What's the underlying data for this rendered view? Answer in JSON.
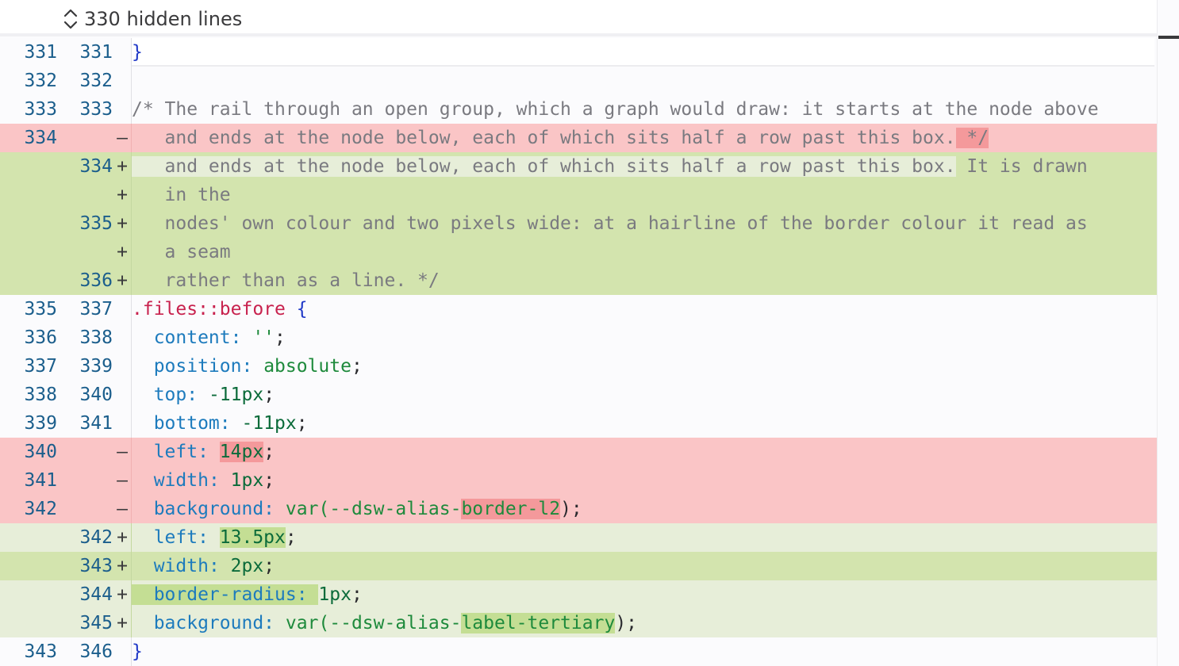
{
  "hidden": {
    "label": "330 hidden lines"
  },
  "lines": [
    {
      "type": "ctx",
      "old": "331",
      "new": "331",
      "sign": "",
      "segments": [
        {
          "t": "}",
          "c": "tok-brace"
        }
      ]
    },
    {
      "type": "ctx",
      "old": "332",
      "new": "332",
      "sign": "",
      "segments": []
    },
    {
      "type": "ctx",
      "old": "333",
      "new": "333",
      "sign": "",
      "segments": [
        {
          "t": "/* The rail through an open group, which a graph would draw: it starts at the node above",
          "c": "tok-comment"
        }
      ]
    },
    {
      "type": "del",
      "old": "334",
      "new": "",
      "sign": "—",
      "segments": [
        {
          "t": "   and ends at the node below, each of which sits half a row past this box.",
          "c": "tok-comment"
        },
        {
          "t": " */",
          "c": "tok-comment hl-del"
        }
      ]
    },
    {
      "type": "add",
      "strong": true,
      "old": "",
      "new": "334",
      "sign": "+",
      "segments": [
        {
          "t": "   and ends at the node below, each of which sits half a row past this box.",
          "c": "tok-comment hl-plain"
        },
        {
          "t": " It is drawn",
          "c": "tok-comment"
        }
      ]
    },
    {
      "type": "add",
      "strong": true,
      "old": "",
      "new": "",
      "sign": "+",
      "segments": [
        {
          "t": "   in the",
          "c": "tok-comment"
        }
      ]
    },
    {
      "type": "add",
      "strong": true,
      "old": "",
      "new": "335",
      "sign": "+",
      "segments": [
        {
          "t": "   nodes' own colour and two pixels wide: at a hairline of the border colour it read as",
          "c": "tok-comment"
        }
      ]
    },
    {
      "type": "add",
      "strong": true,
      "old": "",
      "new": "",
      "sign": "+",
      "segments": [
        {
          "t": "   a seam",
          "c": "tok-comment"
        }
      ]
    },
    {
      "type": "add",
      "strong": true,
      "old": "",
      "new": "336",
      "sign": "+",
      "segments": [
        {
          "t": "   rather than as a line. */",
          "c": "tok-comment"
        }
      ]
    },
    {
      "type": "ctx",
      "old": "335",
      "new": "337",
      "sign": "",
      "segments": [
        {
          "t": ".files::before",
          "c": "tok-selector"
        },
        {
          "t": " {",
          "c": "tok-brace"
        }
      ]
    },
    {
      "type": "ctx",
      "old": "336",
      "new": "338",
      "sign": "",
      "segments": [
        {
          "t": "  content",
          "c": "tok-prop"
        },
        {
          "t": ": ",
          "c": "tok-prop"
        },
        {
          "t": "''",
          "c": "tok-val"
        },
        {
          "t": ";",
          "c": "tok-punct"
        }
      ]
    },
    {
      "type": "ctx",
      "old": "337",
      "new": "339",
      "sign": "",
      "segments": [
        {
          "t": "  position",
          "c": "tok-prop"
        },
        {
          "t": ": ",
          "c": "tok-prop"
        },
        {
          "t": "absolute",
          "c": "tok-val"
        },
        {
          "t": ";",
          "c": "tok-punct"
        }
      ]
    },
    {
      "type": "ctx",
      "old": "338",
      "new": "340",
      "sign": "",
      "segments": [
        {
          "t": "  top",
          "c": "tok-prop"
        },
        {
          "t": ": ",
          "c": "tok-prop"
        },
        {
          "t": "-11px",
          "c": "tok-num"
        },
        {
          "t": ";",
          "c": "tok-punct"
        }
      ]
    },
    {
      "type": "ctx",
      "old": "339",
      "new": "341",
      "sign": "",
      "segments": [
        {
          "t": "  bottom",
          "c": "tok-prop"
        },
        {
          "t": ": ",
          "c": "tok-prop"
        },
        {
          "t": "-11px",
          "c": "tok-num"
        },
        {
          "t": ";",
          "c": "tok-punct"
        }
      ]
    },
    {
      "type": "del",
      "old": "340",
      "new": "",
      "sign": "—",
      "segments": [
        {
          "t": "  left",
          "c": "tok-prop"
        },
        {
          "t": ": ",
          "c": "tok-prop"
        },
        {
          "t": "14px",
          "c": "tok-num hl-del"
        },
        {
          "t": ";",
          "c": "tok-punct"
        }
      ]
    },
    {
      "type": "del",
      "old": "341",
      "new": "",
      "sign": "—",
      "segments": [
        {
          "t": "  width",
          "c": "tok-prop"
        },
        {
          "t": ": ",
          "c": "tok-prop"
        },
        {
          "t": "1px",
          "c": "tok-num"
        },
        {
          "t": ";",
          "c": "tok-punct"
        }
      ]
    },
    {
      "type": "del",
      "old": "342",
      "new": "",
      "sign": "—",
      "segments": [
        {
          "t": "  background",
          "c": "tok-prop"
        },
        {
          "t": ": ",
          "c": "tok-prop"
        },
        {
          "t": "var(--dsw-alias-",
          "c": "tok-val"
        },
        {
          "t": "border-l2",
          "c": "tok-val hl-del"
        },
        {
          "t": ");",
          "c": "tok-punct"
        }
      ]
    },
    {
      "type": "add",
      "strong": false,
      "old": "",
      "new": "342",
      "sign": "+",
      "segments": [
        {
          "t": "  left",
          "c": "tok-prop"
        },
        {
          "t": ": ",
          "c": "tok-prop"
        },
        {
          "t": "13.5px",
          "c": "tok-num hl-add"
        },
        {
          "t": ";",
          "c": "tok-punct"
        }
      ]
    },
    {
      "type": "add",
      "strong": true,
      "old": "",
      "new": "343",
      "sign": "+",
      "segments": [
        {
          "t": "  width",
          "c": "tok-prop"
        },
        {
          "t": ": ",
          "c": "tok-prop"
        },
        {
          "t": "2px",
          "c": "tok-num"
        },
        {
          "t": ";",
          "c": "tok-punct"
        }
      ]
    },
    {
      "type": "add",
      "strong": false,
      "old": "",
      "new": "344",
      "sign": "+",
      "segments": [
        {
          "t": "  border-radius: ",
          "c": "tok-prop hl-add"
        },
        {
          "t": "1px",
          "c": "tok-num"
        },
        {
          "t": ";",
          "c": "tok-punct"
        }
      ]
    },
    {
      "type": "add",
      "strong": false,
      "old": "",
      "new": "345",
      "sign": "+",
      "segments": [
        {
          "t": "  background",
          "c": "tok-prop"
        },
        {
          "t": ": ",
          "c": "tok-prop"
        },
        {
          "t": "var(--dsw-alias-",
          "c": "tok-val"
        },
        {
          "t": "label-tertiary",
          "c": "tok-val hl-add"
        },
        {
          "t": ");",
          "c": "tok-punct"
        }
      ]
    },
    {
      "type": "ctx",
      "old": "343",
      "new": "346",
      "sign": "",
      "segments": [
        {
          "t": "}",
          "c": "tok-brace"
        }
      ]
    }
  ]
}
